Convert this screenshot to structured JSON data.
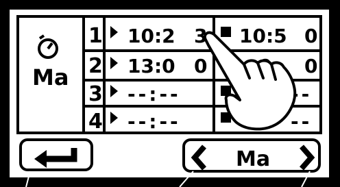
{
  "screen": {
    "day_label": "Ma",
    "icons": {
      "clock": "timer-icon",
      "hand": "pointing-hand-icon",
      "back": "return-arrow-icon",
      "prev": "chevron-left-icon",
      "next": "chevron-right-icon"
    }
  },
  "slots": [
    {
      "number": "1",
      "start": "10:2",
      "start_extra": "3",
      "end": "10:5",
      "end_extra": "0"
    },
    {
      "number": "2",
      "start": "13:0",
      "start_extra": "0",
      "end": ":0",
      "end_extra": "0"
    },
    {
      "number": "3",
      "start": "--:--",
      "start_extra": "",
      "end": "--",
      "end_extra": ""
    },
    {
      "number": "4",
      "start": "--:--",
      "start_extra": "",
      "end": "--",
      "end_extra": ""
    }
  ],
  "nav": {
    "day_selector_label": "Ma"
  },
  "colors": {
    "screen_bg": "#000000",
    "display_bg": "#ffffff",
    "ink": "#000000"
  }
}
